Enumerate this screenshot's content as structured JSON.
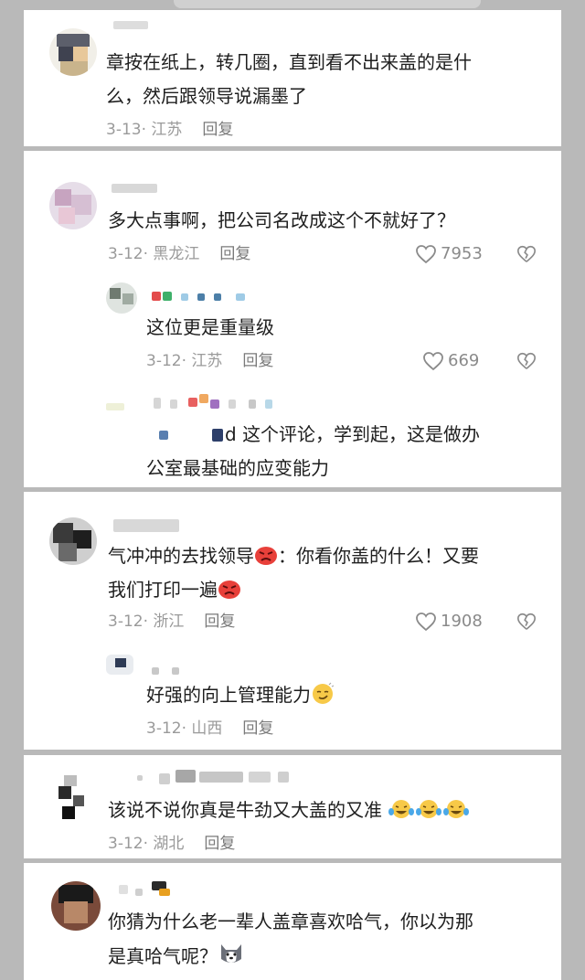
{
  "comments": [
    {
      "text_lines": [
        "章按在纸上，转几圈，直到看不出来盖的是什",
        "么，然后跟领导说漏墨了"
      ],
      "date": "3-13",
      "location": "江苏",
      "reply": "回复"
    },
    {
      "text_lines": [
        "多大点事啊，把公司名改成这个不就好了？"
      ],
      "date": "3-12",
      "location": "黑龙江",
      "reply": "回复",
      "likes": "7953",
      "replies": [
        {
          "text_lines": [
            "这位更是重量级"
          ],
          "date": "3-12",
          "location": "江苏",
          "reply": "回复",
          "likes": "669"
        },
        {
          "mention_suffix": "d",
          "text_lines": [
            "这个评论，学到起，这是做办",
            "公室最基础的应变能力"
          ]
        }
      ]
    },
    {
      "text_lines": [
        "气冲冲的去找领导",
        "：你看你盖的什么！又要",
        "我们打印一遍"
      ],
      "date": "3-12",
      "location": "浙江",
      "reply": "回复",
      "likes": "1908",
      "replies": [
        {
          "text_lines": [
            "好强的向上管理能力"
          ],
          "date": "3-12",
          "location": "山西",
          "reply": "回复"
        }
      ]
    },
    {
      "text_lines": [
        "该说不说你真是牛劲又大盖的又准"
      ],
      "date": "3-12",
      "location": "湖北",
      "reply": "回复"
    },
    {
      "text_lines": [
        "你猜为什么老一辈人盖章喜欢哈气，你以为那",
        "是真哈气呢？"
      ]
    }
  ],
  "icons": {
    "like": "heart-outline-icon",
    "dislike": "broken-heart-icon",
    "angry": "angry-face-emoji",
    "proud": "smug-face-emoji",
    "laughing": "tears-of-joy-emoji",
    "dog": "husky-dog-emoji"
  },
  "colors": {
    "card_bg": "#ffffff",
    "page_bg": "#b9b9b9",
    "meta_text": "#9a9a9a",
    "body_text": "#1e1e1e",
    "angry_red": "#e8403a",
    "emoji_yellow": "#f7c948"
  }
}
